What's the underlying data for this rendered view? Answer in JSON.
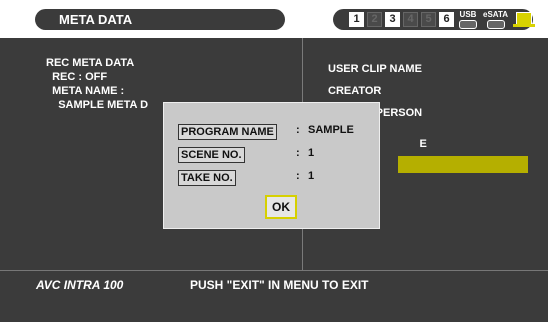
{
  "header": {
    "title": "META DATA",
    "slots": [
      "1",
      "2",
      "3",
      "4",
      "5",
      "6"
    ],
    "usb_label": "USB",
    "esata_label": "eSATA"
  },
  "left_panel": {
    "lines": [
      "REC META DATA",
      "  REC : OFF",
      "  META NAME :",
      "    SAMPLE META D"
    ]
  },
  "right_panel": {
    "lines": [
      "USER CLIP NAME",
      "CREATOR",
      "          TE PERSON",
      "",
      "",
      "        E"
    ]
  },
  "dialog": {
    "rows": [
      {
        "label": "PROGRAM NAME",
        "colon": ":",
        "value": "SAMPLE"
      },
      {
        "label": "SCENE NO.",
        "colon": ":",
        "value": "1"
      },
      {
        "label": "TAKE NO.",
        "colon": ":",
        "value": "1"
      }
    ],
    "ok_label": "OK"
  },
  "footer": {
    "logo": "AVC INTRA 100",
    "status": "PUSH \"EXIT\" IN MENU TO EXIT"
  },
  "colors": {
    "background": "#3b3b3b",
    "highlight": "#b5af00",
    "focus": "#d6d000",
    "dialog": "#c9c9c9"
  }
}
